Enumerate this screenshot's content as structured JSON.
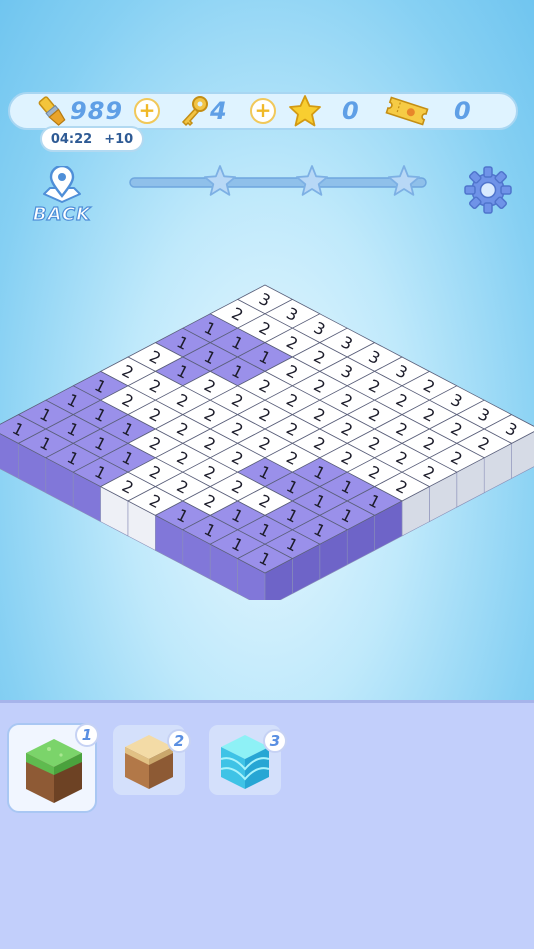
{
  "hud": {
    "brush_count": "989",
    "key_count": "4",
    "star_count": "0",
    "ticket_count": "0",
    "plus_symbol": "+",
    "timer": "04:22",
    "timer_bonus": "+10",
    "back_label": "BACK"
  },
  "progress": {
    "stars_total": 3,
    "stars_earned": 0
  },
  "board": {
    "size": 10,
    "rows": [
      [
        "3",
        "3",
        "3",
        "3",
        "3",
        "3",
        "2",
        "3",
        "3",
        "3"
      ],
      [
        "2",
        "2",
        "2",
        "2",
        "3",
        "2",
        "2",
        "2",
        "2",
        "2"
      ],
      [
        "1",
        "1",
        "1",
        "2",
        "2",
        "2",
        "2",
        "2",
        "2",
        "2"
      ],
      [
        "1",
        "1",
        "1",
        "2",
        "2",
        "2",
        "2",
        "2",
        "2",
        "2"
      ],
      [
        "2",
        "1",
        "2",
        "2",
        "2",
        "2",
        "2",
        "2",
        "2",
        "2"
      ],
      [
        "2",
        "2",
        "2",
        "2",
        "2",
        "2",
        "2",
        "1",
        "1",
        "1"
      ],
      [
        "1",
        "2",
        "2",
        "2",
        "2",
        "2",
        "1",
        "1",
        "1",
        "1"
      ],
      [
        "1",
        "1",
        "1",
        "2",
        "2",
        "2",
        "2",
        "2",
        "1",
        "1"
      ],
      [
        "1",
        "1",
        "1",
        "1",
        "2",
        "2",
        "2",
        "1",
        "1",
        "1"
      ],
      [
        "1",
        "1",
        "1",
        "1",
        "2",
        "2",
        "1",
        "1",
        "1",
        "1"
      ]
    ],
    "colors": {
      "1": "#9a90ea",
      "2": "#ffffff",
      "3": "#ffffff"
    }
  },
  "palette": [
    {
      "number": "1",
      "name": "grass-block"
    },
    {
      "number": "2",
      "name": "sand-block"
    },
    {
      "number": "3",
      "name": "water-block"
    }
  ]
}
